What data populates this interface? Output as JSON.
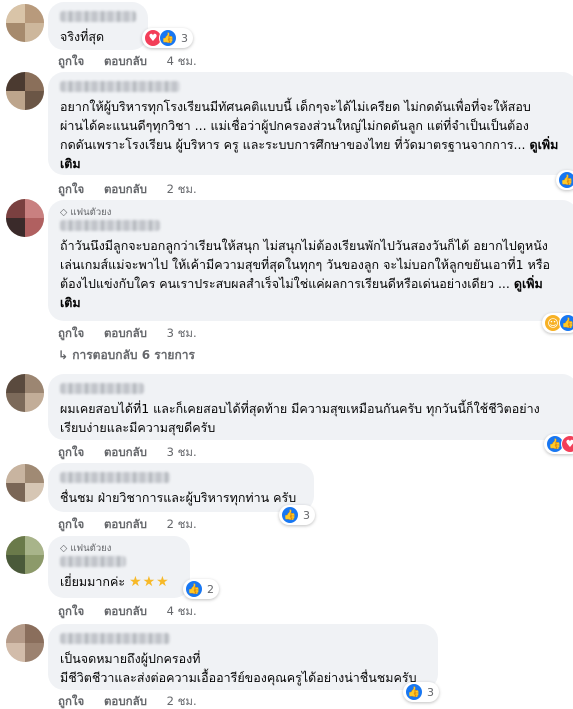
{
  "comments": [
    {
      "text": "จริงที่สุด",
      "fan": "",
      "time": "4 ชม.",
      "reaction_count": "3",
      "reactions": [
        "love-icon",
        "like-icon"
      ],
      "more": ""
    },
    {
      "text": "อยากให้ผู้บริหารทุกโรงเรียนมีทัศนคติแบบนี้ เด็กๆจะได้ไม่เครียด ไม่กดดันเพื่อที่จะให้สอบ\nผ่านได้คะแนนดีๆทุกวิชา ... แม่เชื่อว่าผู้ปกครองส่วนใหญ่ไม่กดดันลูก แต่ที่จำเป็นเป็นต้อง\nกดดันเพราะโรงเรียน ผู้บริหาร ครู และระบบการศึกษาของไทย ที่วัดมาตรฐานจากการ...",
      "more": "ดูเพิ่ม\nเติม",
      "fan": "",
      "time": "2 ชม.",
      "reaction_count": "",
      "reactions": [
        "like-icon"
      ]
    },
    {
      "text": "ถ้าวันนึงมีลูกจะบอกลูกว่าเรียนให้สนุก ไม่สนุกไม่ต้องเรียนพักไปวันสองวันก็ได้ อยากไปดูหนัง\nเล่นเกมส์แม่จะพาไป ให้เค้ามีความสุขที่สุดในทุกๆ วันของลูก จะไม่บอกให้ลูกขยันเอาที่1 หรือ\nต้องไปแข่งกับใคร คนเราประสบผลสำเร็จไม่ใช่แค่ผลการเรียนดีหรือเด่นอย่างเดียว ...",
      "more": "ดูเพิ่ม\nเติม",
      "fan": "แฟนตัวยง",
      "time": "3 ชม.",
      "reaction_count": "",
      "reactions": [
        "haha-icon",
        "like-icon"
      ]
    },
    {
      "text": "ผมเคยสอบได้ที่1 และก็เคยสอบได้ที่สุดท้าย มีความสุขเหมือนกันครับ ทุกวันนี้ก็ใช้ชีวิตอย่าง\nเรียบง่ายและมีความสุขดีครับ",
      "more": "",
      "fan": "",
      "time": "3 ชม.",
      "reaction_count": "",
      "reactions": [
        "like-icon",
        "love-icon"
      ]
    },
    {
      "text": "ชื่นชม ฝ่ายวิชาการและผู้บริหารทุกท่าน ครับ",
      "more": "",
      "fan": "",
      "time": "2 ชม.",
      "reaction_count": "3",
      "reactions": [
        "like-icon"
      ]
    },
    {
      "text": "เยี่ยมมากค่ะ",
      "stars": "★★★",
      "more": "",
      "fan": "แฟนตัวยง",
      "time": "4 ชม.",
      "reaction_count": "2",
      "reactions": [
        "like-icon"
      ]
    },
    {
      "text": "เป็นจดหมายถึงผู้ปกครองที่\nมีชีวิตชีวาและส่งต่อความเอื้ออารีย์ของคุณครูได้อย่างน่าชื่นชมครับ",
      "more": "",
      "fan": "",
      "time": "2 ชม.",
      "reaction_count": "3",
      "reactions": [
        "like-icon"
      ]
    }
  ],
  "labels": {
    "like": "ถูกใจ",
    "reply": "ตอบกลับ"
  },
  "view_replies": "การตอบกลับ 6 รายการ",
  "colors": {
    "bubble": "#f0f2f5",
    "meta": "#65676b",
    "like": "#1877f2",
    "love": "#f33e58"
  }
}
